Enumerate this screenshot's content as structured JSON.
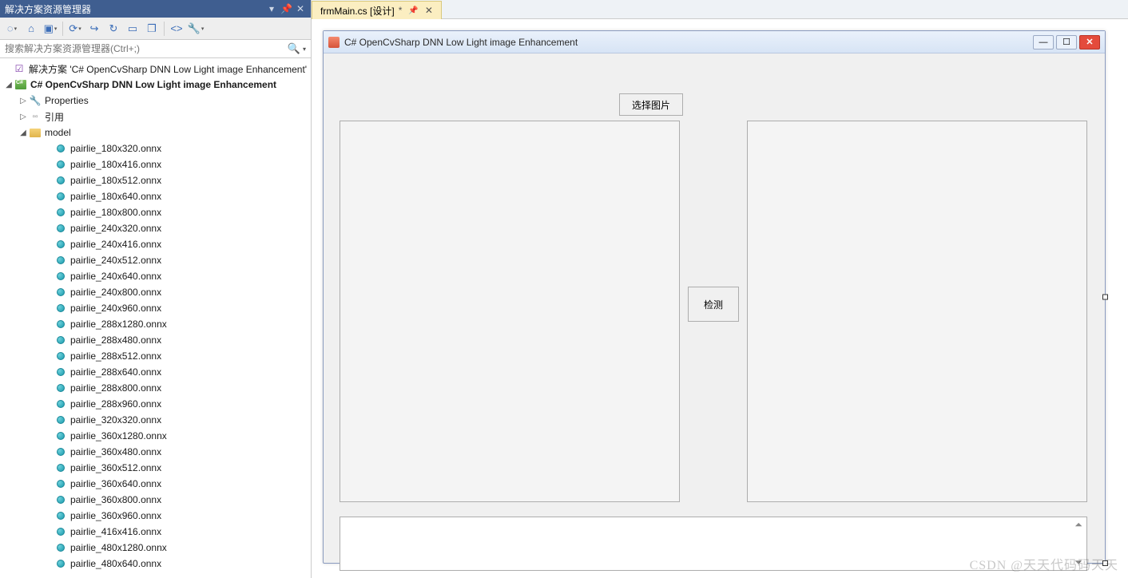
{
  "panel": {
    "title": "解决方案资源管理器",
    "search_placeholder": "搜索解决方案资源管理器(Ctrl+;)"
  },
  "tree": {
    "solution": "解决方案 'C# OpenCvSharp DNN Low Light image Enhancement'",
    "project": "C# OpenCvSharp DNN Low Light image Enhancement",
    "properties": "Properties",
    "references": "引用",
    "folder": "model",
    "files": [
      "pairlie_180x320.onnx",
      "pairlie_180x416.onnx",
      "pairlie_180x512.onnx",
      "pairlie_180x640.onnx",
      "pairlie_180x800.onnx",
      "pairlie_240x320.onnx",
      "pairlie_240x416.onnx",
      "pairlie_240x512.onnx",
      "pairlie_240x640.onnx",
      "pairlie_240x800.onnx",
      "pairlie_240x960.onnx",
      "pairlie_288x1280.onnx",
      "pairlie_288x480.onnx",
      "pairlie_288x512.onnx",
      "pairlie_288x640.onnx",
      "pairlie_288x800.onnx",
      "pairlie_288x960.onnx",
      "pairlie_320x320.onnx",
      "pairlie_360x1280.onnx",
      "pairlie_360x480.onnx",
      "pairlie_360x512.onnx",
      "pairlie_360x640.onnx",
      "pairlie_360x800.onnx",
      "pairlie_360x960.onnx",
      "pairlie_416x416.onnx",
      "pairlie_480x1280.onnx",
      "pairlie_480x640.onnx"
    ]
  },
  "tab": {
    "label": "frmMain.cs [设计]"
  },
  "form": {
    "title": "C# OpenCvSharp DNN Low Light image Enhancement",
    "btn_select": "选择图片",
    "btn_detect": "检测"
  },
  "watermark": "CSDN @天天代码码天天"
}
